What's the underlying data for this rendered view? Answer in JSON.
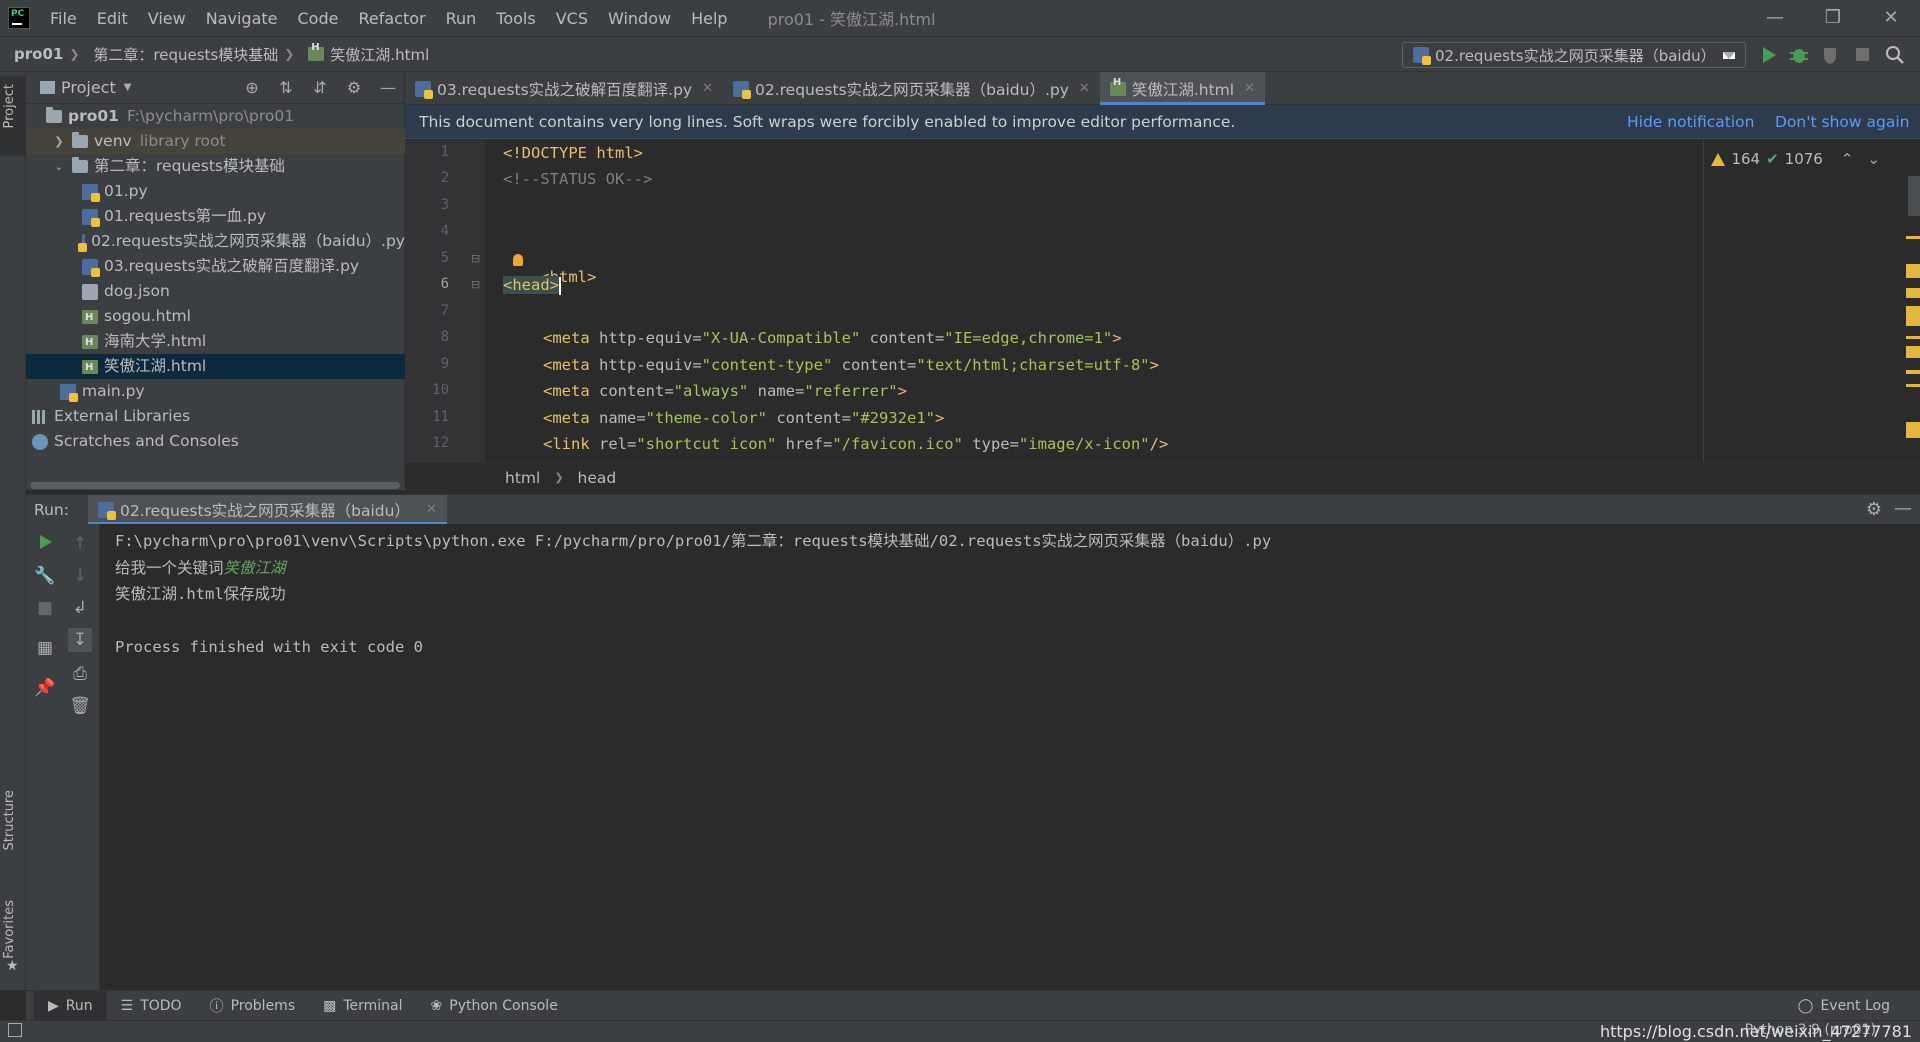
{
  "menu": {
    "items": [
      "File",
      "Edit",
      "View",
      "Navigate",
      "Code",
      "Refactor",
      "Run",
      "Tools",
      "VCS",
      "Window",
      "Help"
    ],
    "window_title": "pro01 - 笑傲江湖.html"
  },
  "navbar": {
    "project": "pro01",
    "folder": "第二章：requests模块基础",
    "file": "笑傲江湖.html",
    "run_config": "02.requests实战之网页采集器（baidu）"
  },
  "left_strip": {
    "project": "Project",
    "structure": "Structure",
    "favorites": "Favorites"
  },
  "project_panel": {
    "title": "Project",
    "tree": [
      {
        "name": "pro01",
        "extra": "F:\\pycharm\\pro\\pro01"
      },
      {
        "name": "venv",
        "extra": "library root"
      },
      {
        "name": "第二章：requests模块基础"
      },
      {
        "name": "01.py"
      },
      {
        "name": "01.requests第一血.py"
      },
      {
        "name": "02.requests实战之网页采集器（baidu）.py"
      },
      {
        "name": "03.requests实战之破解百度翻译.py"
      },
      {
        "name": "dog.json"
      },
      {
        "name": "sogou.html"
      },
      {
        "name": "海南大学.html"
      },
      {
        "name": "笑傲江湖.html"
      },
      {
        "name": "main.py"
      },
      {
        "name": "External Libraries"
      },
      {
        "name": "Scratches and Consoles"
      }
    ]
  },
  "tabs": [
    {
      "label": "03.requests实战之破解百度翻译.py"
    },
    {
      "label": "02.requests实战之网页采集器（baidu）.py"
    },
    {
      "label": "笑傲江湖.html"
    }
  ],
  "notification": {
    "text": "This document contains very long lines. Soft wraps were forcibly enabled to improve editor performance.",
    "hide": "Hide notification",
    "dont_show": "Don't show again"
  },
  "editor": {
    "line_numbers": [
      "1",
      "2",
      "3",
      "4",
      "5",
      "6",
      "7",
      "8",
      "9",
      "10",
      "11",
      "12"
    ],
    "warnings": "164",
    "checks": "1076",
    "lines": {
      "l1_tag": "<!DOCTYPE html>",
      "l2_cmt": "<!--STATUS OK-->",
      "l5_tag": "<html>",
      "l6_tag": "<head>",
      "l8": {
        "open": "<meta ",
        "a1": "http-equiv=",
        "v1": "\"X-UA-Compatible\"",
        "a2": " content=",
        "v2": "\"IE=edge,chrome=1\"",
        "close": ">"
      },
      "l9": {
        "open": "<meta ",
        "a1": "http-equiv=",
        "v1": "\"content-type\"",
        "a2": " content=",
        "v2": "\"text/html;charset=utf-8\"",
        "close": ">"
      },
      "l10": {
        "open": "<meta ",
        "a1": "content=",
        "v1": "\"always\"",
        "a2": " name=",
        "v2": "\"referrer\"",
        "close": ">"
      },
      "l11": {
        "open": "<meta ",
        "a1": "name=",
        "v1": "\"theme-color\"",
        "a2": " content=",
        "v2": "\"#2932e1\"",
        "close": ">"
      },
      "l12": {
        "open": "<link ",
        "a1": "rel=",
        "v1": "\"shortcut icon\"",
        "a2": " href=",
        "v2": "\"/favicon.ico\"",
        "a3": " type=",
        "v3": "\"image/x-icon\"",
        "close": "/>"
      }
    },
    "breadcrumb": [
      "html",
      "head"
    ]
  },
  "run_panel": {
    "label": "Run:",
    "tab": "02.requests实战之网页采集器（baidu）",
    "console": {
      "cmd": "F:\\pycharm\\pro\\pro01\\venv\\Scripts\\python.exe F:/pycharm/pro/pro01/第二章：requests模块基础/02.requests实战之网页采集器（baidu）.py",
      "prompt": "给我一个关键词",
      "user_input": "笑傲江湖",
      "saved": "笑傲江湖.html保存成功",
      "blank": "",
      "finished": "Process finished with exit code 0"
    }
  },
  "bottom_tabs": [
    "Run",
    "TODO",
    "Problems",
    "Terminal",
    "Python Console"
  ],
  "status": {
    "event_log": "Event Log",
    "watermark": "https://blog.csdn.net/weixin_47277781",
    "interpreter": "Python 3.9 (pro01)"
  },
  "colors": {
    "accent": "#4a88c7",
    "tag": "#e8bf6a",
    "string": "#a5c25c",
    "link": "#589df6",
    "warning": "#e2b93d",
    "run_green": "#499c54"
  }
}
